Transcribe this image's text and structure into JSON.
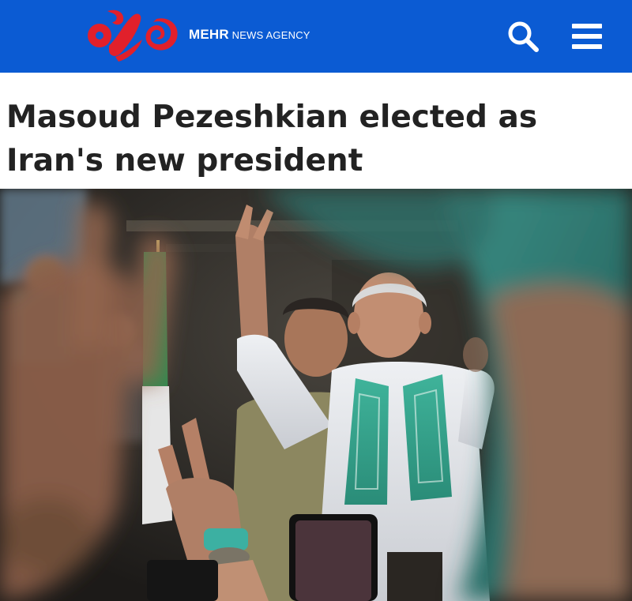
{
  "header": {
    "brand_bold": "MEHR",
    "brand_rest": " NEWS AGENCY",
    "background_color": "#0b5bd3",
    "logo_color": "#e1202b",
    "search_icon": "search-icon",
    "menu_icon": "hamburger-menu-icon"
  },
  "article": {
    "headline": "Masoud Pezeshkian elected as Iran's new president",
    "photo_subject": "photo"
  }
}
